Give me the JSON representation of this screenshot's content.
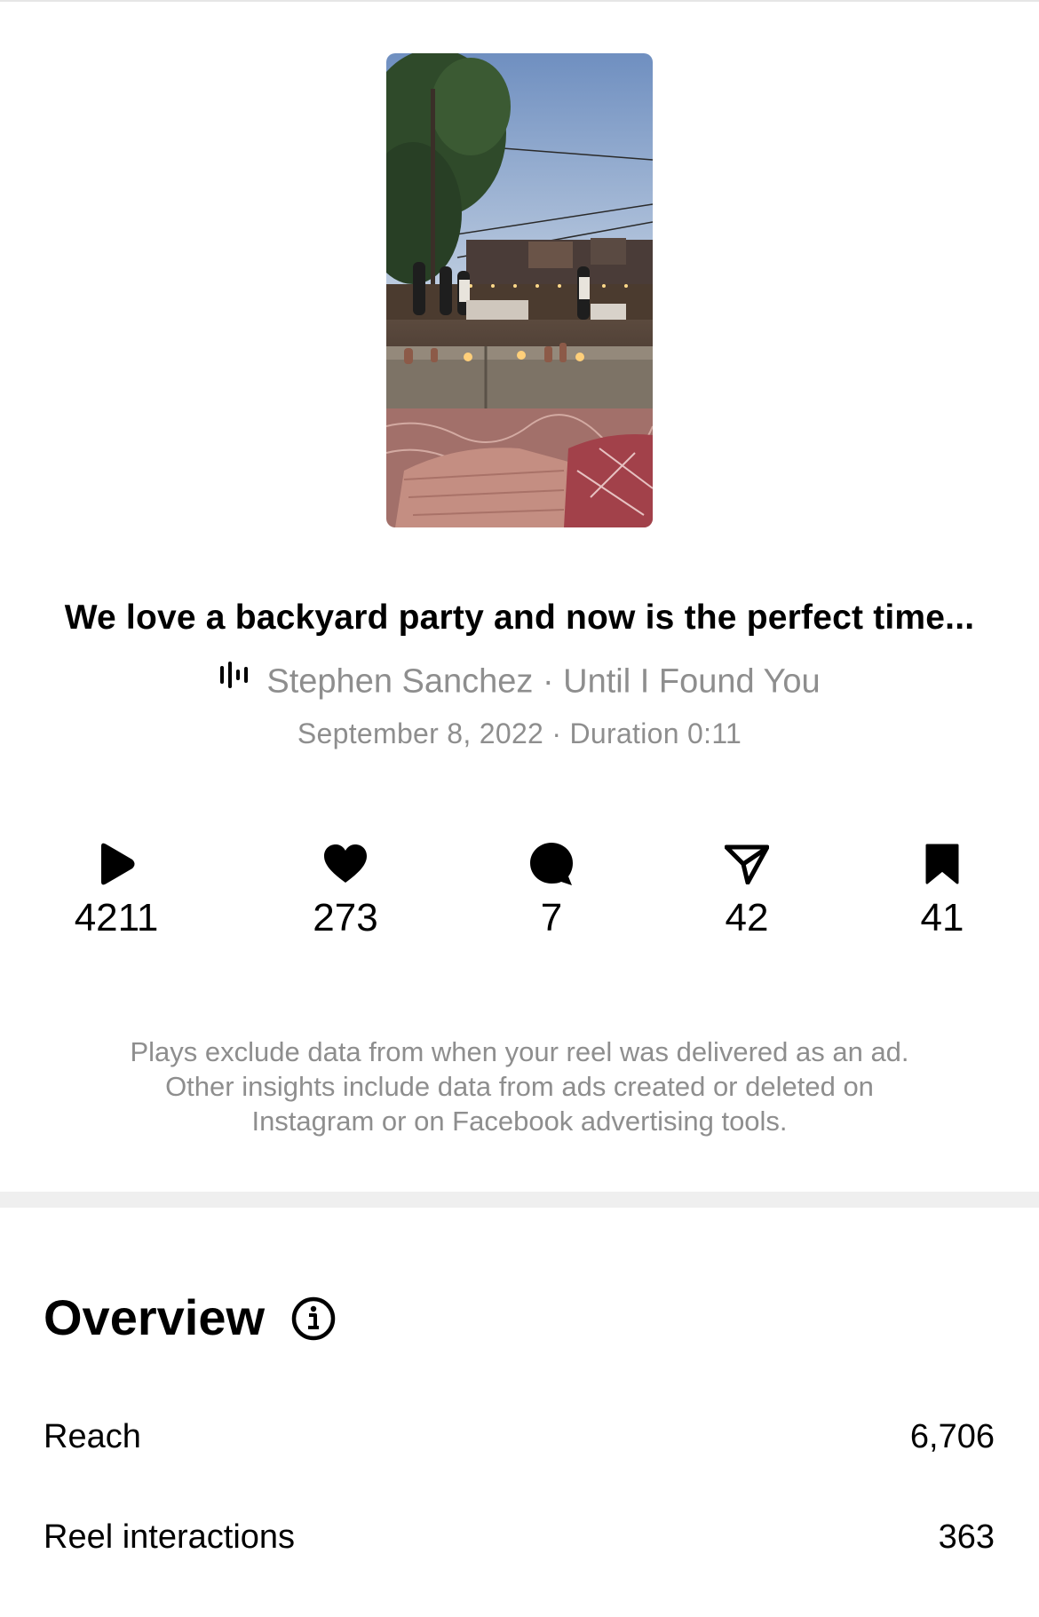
{
  "reel": {
    "caption": "We love a backyard party and now is the perfect time...",
    "audio": "Stephen Sanchez · Until I Found You",
    "meta": "September 8, 2022 · Duration 0:11"
  },
  "stats": {
    "plays": "4211",
    "likes": "273",
    "comments": "7",
    "shares": "42",
    "saves": "41"
  },
  "disclaimer": {
    "line1": "Plays exclude data from when your reel was delivered as an ad.",
    "line2": "Other insights include data from ads created or deleted on",
    "line3": "Instagram or on Facebook advertising tools."
  },
  "overview": {
    "title": "Overview",
    "rows": [
      {
        "label": "Reach",
        "value": "6,706"
      },
      {
        "label": "Reel interactions",
        "value": "363"
      }
    ]
  },
  "icons": {
    "plays": "play-icon",
    "likes": "heart-icon",
    "comments": "comment-bubble-icon",
    "shares": "send-paper-plane-icon",
    "saves": "bookmark-icon",
    "audio": "audio-waveform-icon",
    "info": "info-circle-icon"
  },
  "colors": {
    "secondary_text": "#8e8e8e",
    "primary_text": "#000000",
    "divider": "#efefef"
  }
}
